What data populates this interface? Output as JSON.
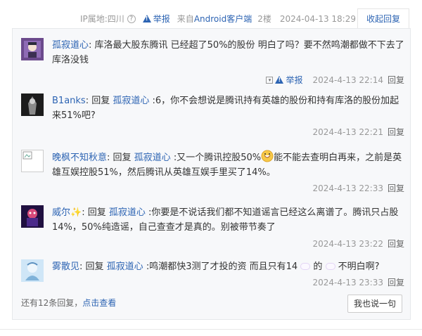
{
  "header": {
    "ip_location": "IP属地:四川",
    "report_label": "举报",
    "from_prefix": "来自",
    "from_client": "Android客户端",
    "floor": "2楼",
    "datetime": "2024-04-13 18:29",
    "collapse_label": "收起回复"
  },
  "replies": [
    {
      "user": "孤寂道心",
      "sep": ": ",
      "text": "库洛最大股东腾讯 已经超了50%的股份 明白了吗？要不然鸣潮都做不下去了 库洛没钱",
      "report": "举报",
      "time": "2024-4-13 22:14",
      "reply_label": "回复"
    },
    {
      "user": "B1anks",
      "prefix": ": 回复 ",
      "target": "孤寂道心",
      "text": " :6，你不会想说是腾讯持有英雄的股份和持有库洛的股份加起来51%吧?",
      "time": "2024-4-13 22:21",
      "reply_label": "回复"
    },
    {
      "user": "晚枫不知秋意",
      "prefix": ": 回复 ",
      "target": "孤寂道心",
      "text_a": " :又一个腾讯控股50%",
      "text_b": "能不能去查明白再来，之前是英雄互娱控股51%，然后腾讯从英雄互娱手里买了14%。",
      "time": "2024-4-13 22:33",
      "reply_label": "回复"
    },
    {
      "user": "威尔",
      "prefix": ": 回复 ",
      "target": "孤寂道心",
      "text": " :你要是不说话我们都不知道谣言已经这么离谱了。腾讯只占股14%，50%纯造谣，自己查查才是真的。别被带节奏了",
      "time": "2024-4-13 23:22",
      "reply_label": "回复"
    },
    {
      "user": "雾散见",
      "prefix": ": 回复 ",
      "target": "孤寂道心",
      "text_a": " :鸣潮都快3测了才投的资 而且只有14 ",
      "text_b": " 的 ",
      "text_c": " 不明白啊?",
      "time": "2024-4-13 23:33",
      "reply_label": "回复"
    }
  ],
  "footer": {
    "more_text": "还有12条回复，",
    "more_link": "点击查看",
    "say_button": "我也说一句"
  },
  "colors": {
    "link": "#2d64b3",
    "meta": "#999999",
    "panel_bg": "#f7f8fa"
  }
}
